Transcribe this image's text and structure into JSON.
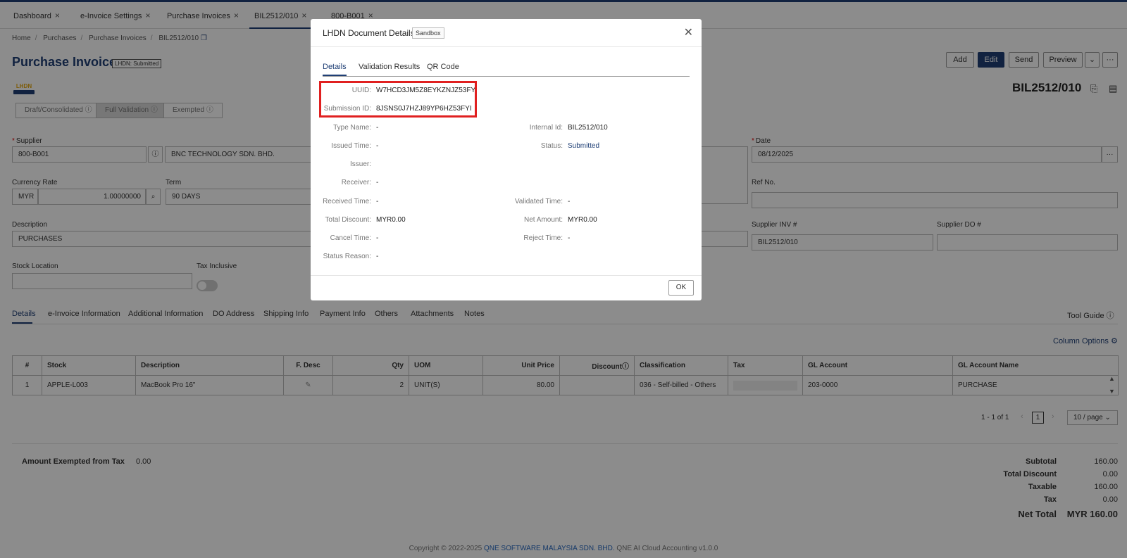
{
  "top_tabs": [
    {
      "label": "Dashboard"
    },
    {
      "label": "e-Invoice Settings"
    },
    {
      "label": "Purchase Invoices"
    },
    {
      "label": "BIL2512/010"
    },
    {
      "label": "800-B001"
    }
  ],
  "breadcrumb": [
    "Home",
    "Purchases",
    "Purchase Invoices",
    "BIL2512/010"
  ],
  "page": {
    "title": "Purchase Invoice",
    "lhdn_status": "LHDN: Submitted",
    "logo_text": "LHDN",
    "doc_number": "BIL2512/010"
  },
  "validation_modes": [
    "Draft/Consolidated",
    "Full Validation",
    "Exempted"
  ],
  "toolbar": {
    "add": "Add",
    "edit": "Edit",
    "send": "Send",
    "preview": "Preview",
    "more": "···",
    "dropdown": "⌄"
  },
  "form": {
    "supplier_label": "Supplier",
    "supplier_code": "800-B001",
    "supplier_name": "BNC TECHNOLOGY SDN. BHD.",
    "currency_rate_label": "Currency Rate",
    "currency": "MYR",
    "rate": "1.00000000",
    "term_label": "Term",
    "term": "90 DAYS",
    "description_label": "Description",
    "description": "PURCHASES",
    "stock_location_label": "Stock Location",
    "tax_inclusive_label": "Tax Inclusive",
    "date_label": "Date",
    "date": "08/12/2025",
    "ref_no_label": "Ref No.",
    "supplier_inv_label": "Supplier INV #",
    "supplier_inv": "BIL2512/010",
    "supplier_do_label": "Supplier DO #"
  },
  "sub_tabs": [
    "Details",
    "e-Invoice Information",
    "Additional Information",
    "DO Address",
    "Shipping Info",
    "Payment Info",
    "Others",
    "Attachments",
    "Notes"
  ],
  "tool_guide": "Tool Guide",
  "column_options": "Column Options",
  "table": {
    "headers": [
      "#",
      "Stock",
      "Description",
      "F. Desc",
      "Qty",
      "UOM",
      "Unit Price",
      "Discount",
      "Classification",
      "Tax",
      "GL Account",
      "GL Account Name"
    ],
    "rows": [
      [
        "1",
        "APPLE-L003",
        "MacBook Pro 16\"",
        "",
        "2",
        "UNIT(S)",
        "80.00",
        "",
        "036 - Self-billed - Others",
        "",
        "203-0000",
        "PURCHASE"
      ]
    ]
  },
  "pagination": {
    "range": "1 - 1 of 1",
    "page": "1",
    "per_page": "10 / page"
  },
  "totals": {
    "exempted_label": "Amount Exempted from Tax",
    "exempted_value": "0.00",
    "subtotal_label": "Subtotal",
    "subtotal": "160.00",
    "discount_label": "Total Discount",
    "discount": "0.00",
    "taxable_label": "Taxable",
    "taxable": "160.00",
    "tax_label": "Tax",
    "tax": "0.00",
    "net_label": "Net Total",
    "net": "MYR 160.00"
  },
  "modal": {
    "title": "LHDN Document Details",
    "env": "Sandbox",
    "tabs": [
      "Details",
      "Validation Results",
      "QR Code"
    ],
    "fields": {
      "uuid_label": "UUID:",
      "uuid": "W7HCD3JM5Z8EYKZNJZ53FY",
      "submission_label": "Submission ID:",
      "submission": "8JSNS0J7HZJ89YP6HZ53FYI",
      "type_label": "Type Name:",
      "type": "-",
      "internal_label": "Internal Id:",
      "internal": "BIL2512/010",
      "issued_label": "Issued Time:",
      "issued": "-",
      "status_label": "Status:",
      "status": "Submitted",
      "issuer_label": "Issuer:",
      "receiver_label": "Receiver:",
      "receiver": "-",
      "received_label": "Received Time:",
      "received": "-",
      "validated_label": "Validated Time:",
      "validated": "-",
      "total_discount_label": "Total Discount:",
      "total_discount": "MYR0.00",
      "net_amount_label": "Net Amount:",
      "net_amount": "MYR0.00",
      "cancel_label": "Cancel Time:",
      "cancel": "-",
      "reject_label": "Reject Time:",
      "reject": "-",
      "reason_label": "Status Reason:",
      "reason": "-"
    },
    "ok": "OK"
  },
  "footer": {
    "prefix": "Copyright © 2022-2025 ",
    "company": "QNE SOFTWARE MALAYSIA SDN. BHD.",
    "suffix": " QNE AI Cloud Accounting v1.0.0"
  },
  "colors": {
    "brand": "#1f3f75",
    "highlight": "#e02020"
  }
}
